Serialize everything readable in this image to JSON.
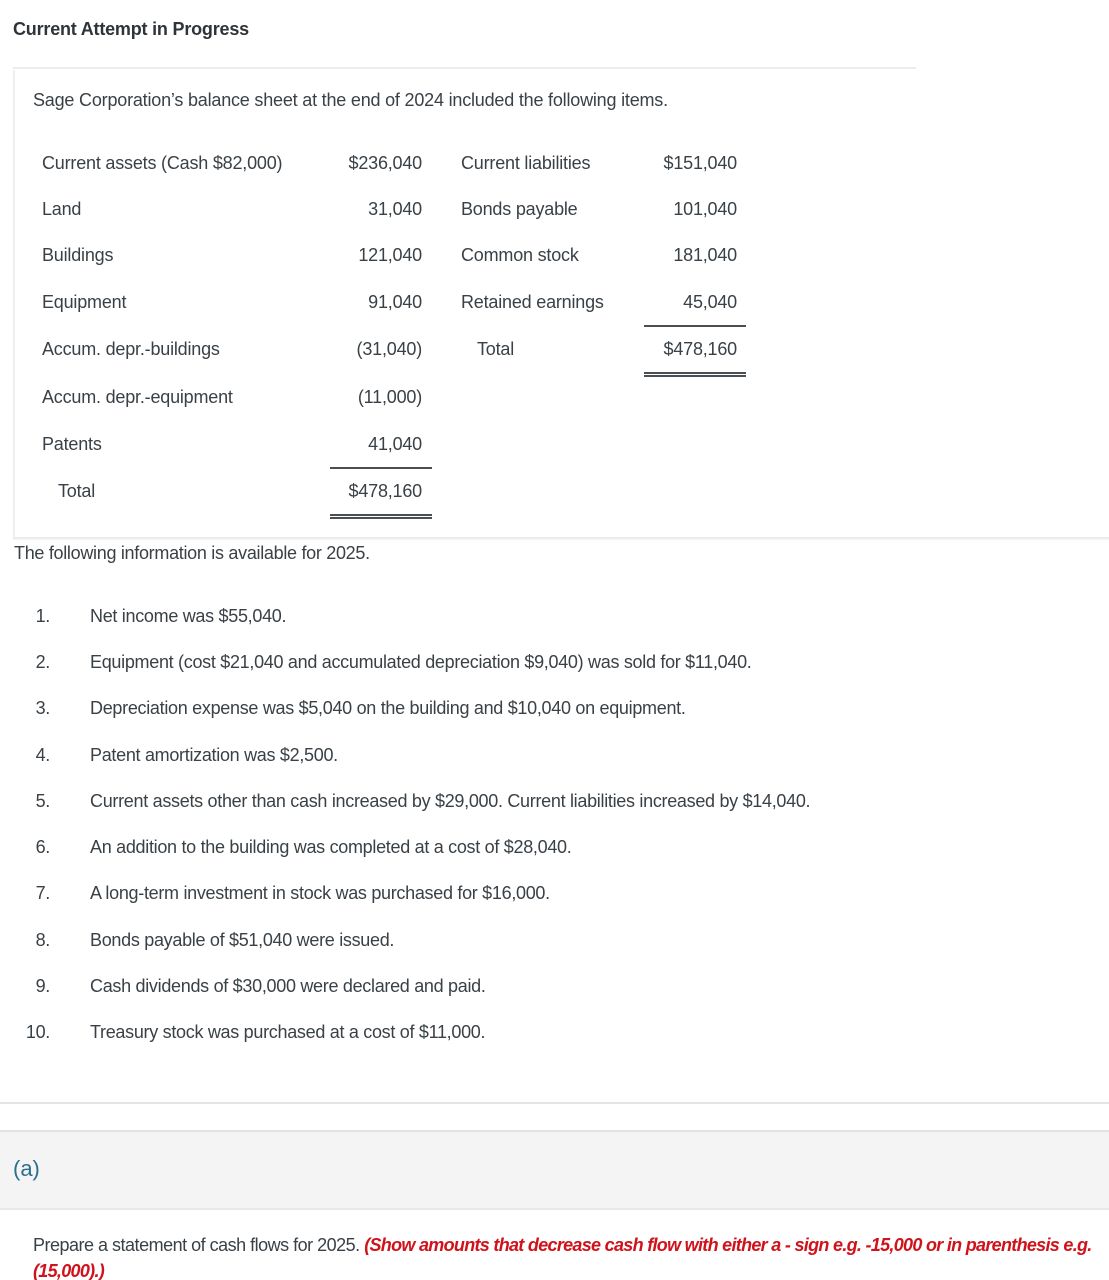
{
  "header": {
    "attempt_title": "Current Attempt in Progress"
  },
  "problem": {
    "intro": "Sage Corporation’s balance sheet at the end of 2024 included the following items.",
    "balance_sheet": {
      "assets": [
        {
          "label": "Current assets (Cash $82,000)",
          "amount": "$236,040"
        },
        {
          "label": "Land",
          "amount": "31,040"
        },
        {
          "label": "Buildings",
          "amount": "121,040"
        },
        {
          "label": "Equipment",
          "amount": "91,040"
        },
        {
          "label": "Accum. depr.-buildings",
          "amount": "(31,040)"
        },
        {
          "label": "Accum. depr.-equipment",
          "amount": "(11,000)"
        },
        {
          "label": "Patents",
          "amount": "41,040"
        }
      ],
      "assets_total": {
        "label": "Total",
        "amount": "$478,160"
      },
      "liabilities_equity": [
        {
          "label": "Current liabilities",
          "amount": "$151,040"
        },
        {
          "label": "Bonds payable",
          "amount": "101,040"
        },
        {
          "label": "Common stock",
          "amount": "181,040"
        },
        {
          "label": "Retained earnings",
          "amount": "45,040"
        }
      ],
      "liabilities_equity_total": {
        "label": "Total",
        "amount": "$478,160"
      }
    },
    "following_heading": "The following information is available for 2025.",
    "info_items": [
      {
        "num": "1.",
        "text": "Net income was $55,040."
      },
      {
        "num": "2.",
        "text": "Equipment (cost $21,040 and accumulated depreciation $9,040) was sold for $11,040."
      },
      {
        "num": "3.",
        "text": "Depreciation expense was $5,040 on the building and $10,040 on equipment."
      },
      {
        "num": "4.",
        "text": "Patent amortization was $2,500."
      },
      {
        "num": "5.",
        "text": "Current assets other than cash increased by $29,000. Current liabilities increased by $14,040."
      },
      {
        "num": "6.",
        "text": "An addition to the building was completed at a cost of $28,040."
      },
      {
        "num": "7.",
        "text": "A long-term investment in stock was purchased for $16,000."
      },
      {
        "num": "8.",
        "text": "Bonds payable of $51,040 were issued."
      },
      {
        "num": "9.",
        "text": "Cash dividends of $30,000 were declared and paid."
      },
      {
        "num": "10.",
        "text": "Treasury stock was purchased at a cost of $11,000."
      }
    ]
  },
  "part_a": {
    "label": "(a)",
    "instruction": "Prepare a statement of cash flows for 2025. ",
    "note": "(Show amounts that decrease cash flow with either a - sign e.g. -15,000 or in parenthesis e.g. (15,000).)"
  },
  "colors": {
    "note_red": "#d0121b",
    "part_label_blue": "#2a6f8c"
  }
}
